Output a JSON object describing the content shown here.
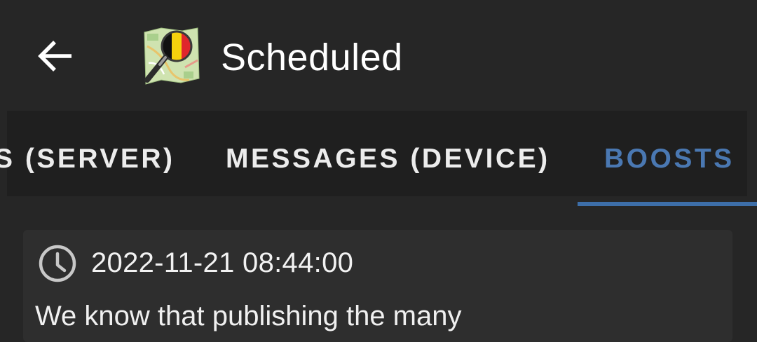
{
  "appbar": {
    "title": "Scheduled",
    "back_icon": "arrow-left-icon",
    "logo_icon": "openstreetmap-belgium-logo"
  },
  "tabs": [
    {
      "label": "S (SERVER)",
      "active": false
    },
    {
      "label": "MESSAGES (DEVICE)",
      "active": false
    },
    {
      "label": "BOOSTS",
      "active": true
    }
  ],
  "post": {
    "clock_icon": "clock-icon",
    "scheduled_at": "2022-11-21 08:44:00",
    "text_preview": "We know that publishing the many"
  },
  "colors": {
    "background": "#262626",
    "tab_strip": "#1f1f1f",
    "accent": "#4a78b2",
    "card": "#2e2e2e",
    "text": "#ffffff"
  }
}
